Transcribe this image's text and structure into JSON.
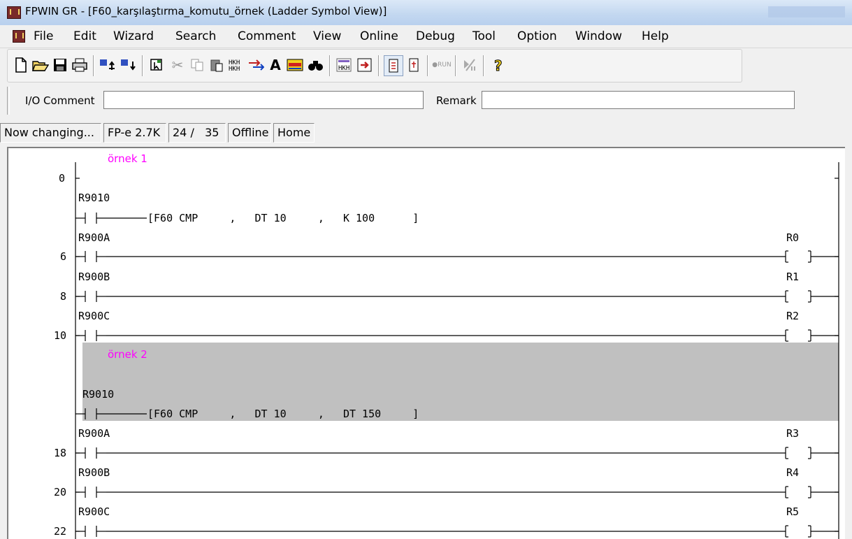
{
  "window": {
    "title": "FPWIN GR - [F60_karşılaştırma_komutu_örnek (Ladder Symbol View)]"
  },
  "menu": [
    "File",
    "Edit",
    "Wizard",
    "Search",
    "Comment",
    "View",
    "Online",
    "Debug",
    "Tool",
    "Option",
    "Window",
    "Help"
  ],
  "toolbar": {
    "icons": [
      "new-file-icon",
      "open-folder-icon",
      "save-icon",
      "print-icon",
      "upload-icon",
      "download-icon",
      "select-icon",
      "cut-icon",
      "copy-icon",
      "paste-icon",
      "block-icon",
      "convert-icon",
      "text-icon",
      "comment-icon",
      "find-icon",
      "monitor-icon",
      "compile-icon",
      "plc-icon",
      "plc-online-icon",
      "run-icon",
      "prog-icon",
      "help-icon"
    ]
  },
  "comment_bar": {
    "io_comment_label": "I/O Comment",
    "io_comment_value": "",
    "remark_label": "Remark",
    "remark_value": ""
  },
  "status": {
    "mode": "Now changing...",
    "plc": "FP-e 2.7K",
    "steps": "24 /   35",
    "online": "Offline",
    "position": "Home"
  },
  "ladder": {
    "comments": [
      "örnek 1",
      "örnek 2"
    ],
    "step_numbers": [
      "0",
      "6",
      "8",
      "10",
      "18",
      "20",
      "22"
    ],
    "rungs": [
      {
        "contact": "R9010",
        "instr": "[F60 CMP     ,   DT 10     ,   K 100      ]"
      },
      {
        "step": "6",
        "contact": "R900A",
        "coil": "R0"
      },
      {
        "step": "8",
        "contact": "R900B",
        "coil": "R1"
      },
      {
        "step": "10",
        "contact": "R900C",
        "coil": "R2"
      },
      {
        "contact": "R9010",
        "instr": "[F60 CMP     ,   DT 10     ,   DT 150     ]"
      },
      {
        "step": "18",
        "contact": "R900A",
        "coil": "R3"
      },
      {
        "step": "20",
        "contact": "R900B",
        "coil": "R4"
      },
      {
        "step": "22",
        "contact": "R900C",
        "coil": "R5"
      }
    ]
  }
}
